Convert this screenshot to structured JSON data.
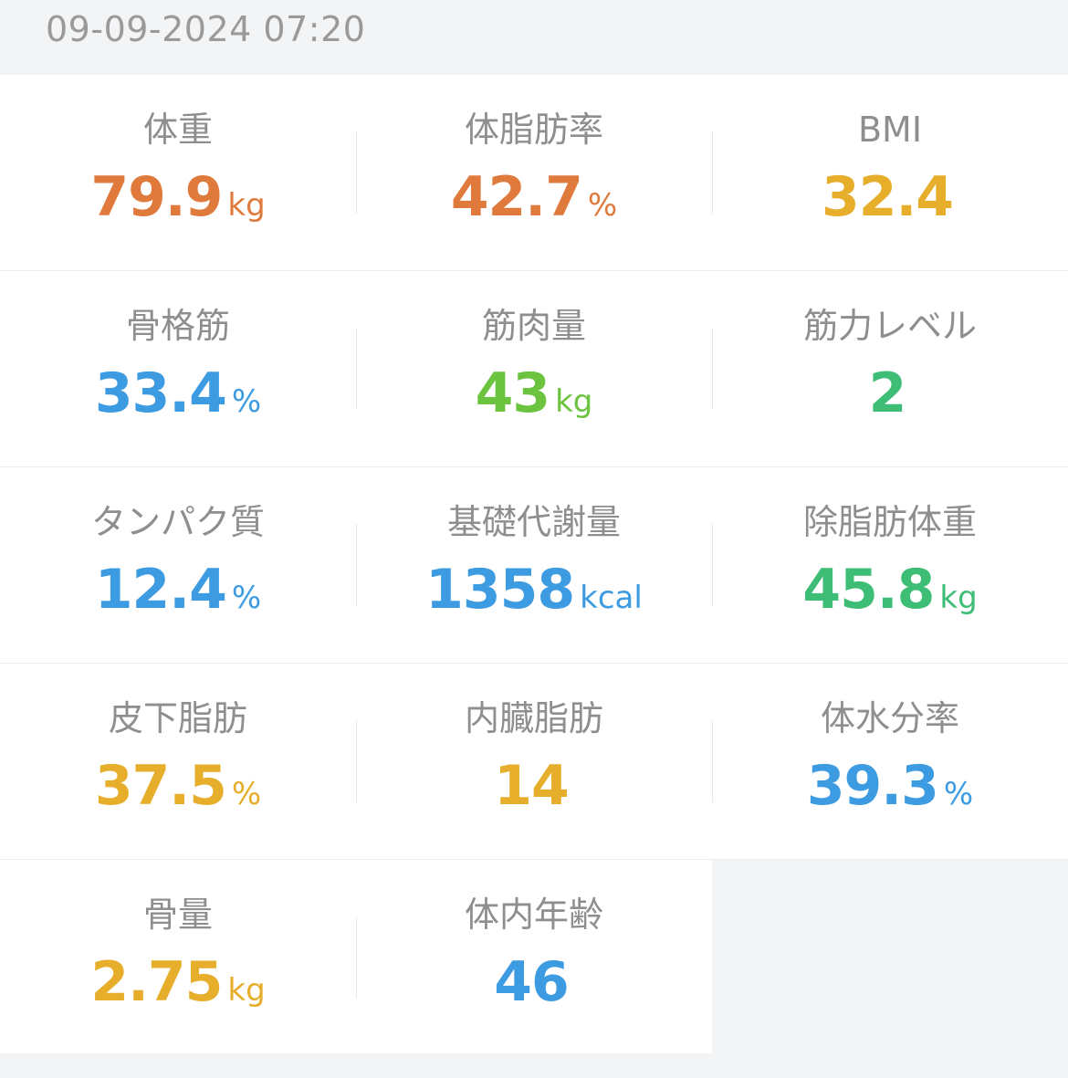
{
  "header": {
    "timestamp": "09-09-2024 07:20"
  },
  "colors": {
    "orange": "#e07a3c",
    "yellow": "#e6ae2a",
    "blue": "#3d9be2",
    "green_light": "#6cc340",
    "green": "#3dbd76",
    "label_gray": "#8e8e8e",
    "timestamp_gray": "#9a9a9a",
    "background": "#f3f4f6"
  },
  "metrics": [
    {
      "label": "体重",
      "value": "79.9",
      "unit": "kg",
      "color": "#e07a3c"
    },
    {
      "label": "体脂肪率",
      "value": "42.7",
      "unit": "%",
      "color": "#e07a3c"
    },
    {
      "label": "BMI",
      "value": "32.4",
      "unit": "",
      "color": "#e6ae2a"
    },
    {
      "label": "骨格筋",
      "value": "33.4",
      "unit": "%",
      "color": "#3d9be2"
    },
    {
      "label": "筋肉量",
      "value": "43",
      "unit": "kg",
      "color": "#6cc340"
    },
    {
      "label": "筋力レベル",
      "value": "2",
      "unit": "",
      "color": "#3dbd76"
    },
    {
      "label": "タンパク質",
      "value": "12.4",
      "unit": "%",
      "color": "#3d9be2"
    },
    {
      "label": "基礎代謝量",
      "value": "1358",
      "unit": "kcal",
      "color": "#3d9be2"
    },
    {
      "label": "除脂肪体重",
      "value": "45.8",
      "unit": "kg",
      "color": "#3dbd76"
    },
    {
      "label": "皮下脂肪",
      "value": "37.5",
      "unit": "%",
      "color": "#e6ae2a"
    },
    {
      "label": "内臓脂肪",
      "value": "14",
      "unit": "",
      "color": "#e6ae2a"
    },
    {
      "label": "体水分率",
      "value": "39.3",
      "unit": "%",
      "color": "#3d9be2"
    },
    {
      "label": "骨量",
      "value": "2.75",
      "unit": "kg",
      "color": "#e6ae2a"
    },
    {
      "label": "体内年齢",
      "value": "46",
      "unit": "",
      "color": "#3d9be2"
    }
  ]
}
